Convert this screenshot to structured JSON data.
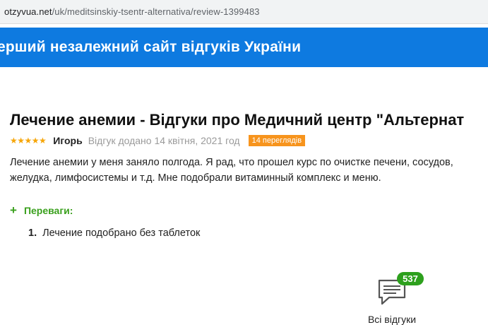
{
  "browser": {
    "url_host": "otzyvua.net",
    "url_path": "/uk/meditsinskiy-tsentr-alternativa/review-1399483"
  },
  "banner": {
    "text": "ерший незалежний сайт відгуків України"
  },
  "review": {
    "title": "Лечение анемии - Відгуки про Медичний центр \"Альтернат",
    "stars": "★★★★★",
    "rating": 5,
    "author": "Игорь",
    "date": "Відгук додано 14 квітня, 2021 год",
    "views": "14 переглядів",
    "text_line1": "Лечение анемии у меня заняло полгода. Я рад, что прошел курс по очистке печени, сосудов,",
    "text_line2": "желудка, лимфосистемы и т.д. Мне подобрали витаминный комплекс и меню."
  },
  "pros": {
    "icon": "plus-icon",
    "label": "Переваги:",
    "items": [
      {
        "num": "1.",
        "text": "Лечение подобрано без таблеток"
      }
    ]
  },
  "all_reviews": {
    "icon": "speech-bubble-icon",
    "count": "537",
    "label": "Всі відгуки"
  },
  "colors": {
    "banner": "#0e7ae0",
    "stars": "#f6a609",
    "views_badge": "#f7941d",
    "pros": "#3aa01d",
    "count_badge": "#2da01d"
  }
}
